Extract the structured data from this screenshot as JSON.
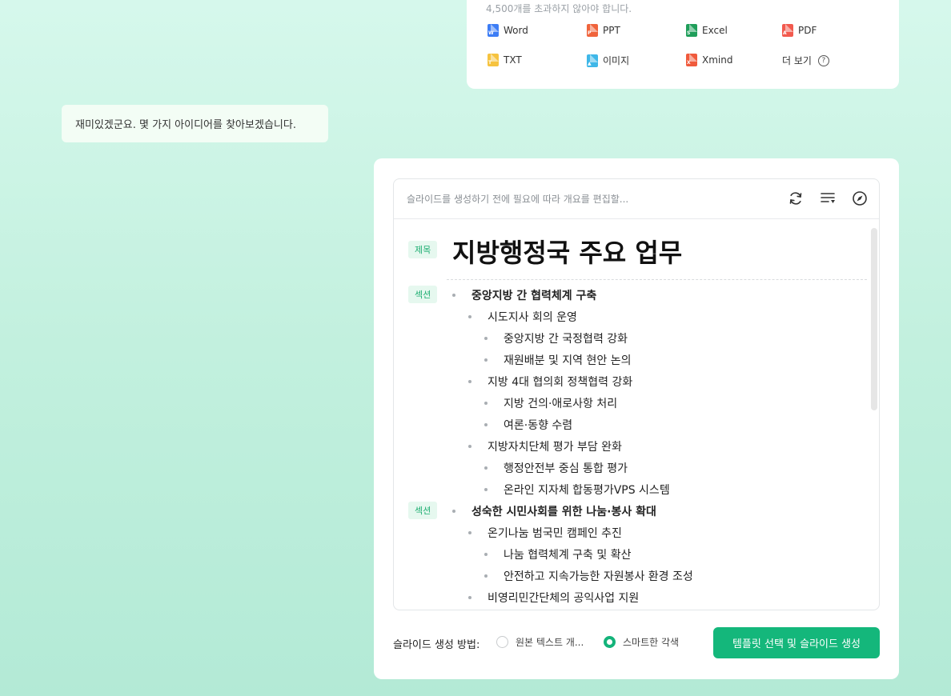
{
  "file_card": {
    "limit_text": "4,500개를 초과하지 않아야 합니다.",
    "items": [
      {
        "label": "Word",
        "icon": "word-file-icon",
        "color": "#3d7df5",
        "glyph": "W"
      },
      {
        "label": "PPT",
        "icon": "ppt-file-icon",
        "color": "#f0643c",
        "glyph": "P"
      },
      {
        "label": "Excel",
        "icon": "excel-file-icon",
        "color": "#1f9e5a",
        "glyph": "S"
      },
      {
        "label": "PDF",
        "icon": "pdf-file-icon",
        "color": "#f25a4e",
        "glyph": "A"
      },
      {
        "label": "TXT",
        "icon": "txt-file-icon",
        "color": "#f6c33f",
        "glyph": "T"
      },
      {
        "label": "이미지",
        "icon": "image-file-icon",
        "color": "#3fb7e8",
        "glyph": "▲"
      },
      {
        "label": "Xmind",
        "icon": "xmind-file-icon",
        "color": "#f05a3c",
        "glyph": "X"
      }
    ],
    "more_label": "더 보기",
    "help_glyph": "?"
  },
  "message": {
    "text": "재미있겠군요. 몇 가지 아이디어를 찾아보겠습니다."
  },
  "outline": {
    "hint": "슬라이드를 생성하기 전에 필요에 따라 개요를 편집할...",
    "tools": [
      "refresh-icon",
      "outline-sort-icon",
      "compass-icon"
    ],
    "title_tag": "제목",
    "title": "지방행정국 주요 업무",
    "section_tag": "섹션",
    "sections": [
      {
        "heading": "중앙지방 간 협력체계 구축",
        "items": [
          {
            "text": "시도지사 회의 운영",
            "children": [
              "중앙지방 간 국정협력 강화",
              "재원배분 및 지역 현안 논의"
            ]
          },
          {
            "text": "지방 4대 협의회 정책협력 강화",
            "children": [
              "지방 건의·애로사항 처리",
              "여론·동향 수렴"
            ]
          },
          {
            "text": "지방자치단체 평가 부담 완화",
            "children": [
              "행정안전부 중심 통합 평가",
              "온라인 지자체 합동평가VPS 시스템"
            ]
          }
        ]
      },
      {
        "heading": "성숙한 시민사회를 위한 나눔·봉사 확대",
        "items": [
          {
            "text": "온기나눔 범국민 캠페인 추진",
            "children": [
              "나눔 협력체계 구축 및 확산",
              "안전하고 지속가능한 자원봉사 환경 조성"
            ]
          },
          {
            "text": "비영리민간단체의 공익사업 지원",
            "children": []
          }
        ]
      }
    ]
  },
  "footer": {
    "method_label": "슬라이드 생성 방법:",
    "option_original": "원본 텍스트 개...",
    "option_smart": "스마트한 각색",
    "selected": "smart",
    "generate_label": "템플릿 선택 및 슬라이드 생성",
    "accent": "#14b77b"
  }
}
